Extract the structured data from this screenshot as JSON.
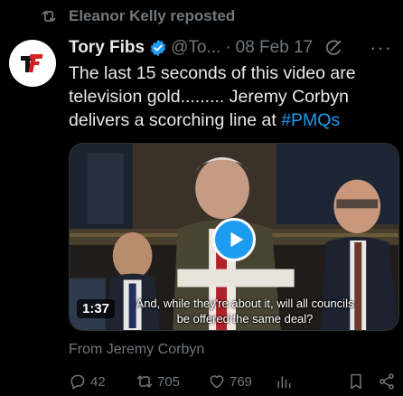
{
  "repost": {
    "icon": "repost-icon",
    "text": "Eleanor Kelly reposted"
  },
  "author": {
    "name": "Tory Fibs",
    "handle": "@To...",
    "separator": "·",
    "date": "08 Feb 17",
    "avatar_text": "TF"
  },
  "tweet": {
    "text_before": "The last 15 seconds of this video are television gold......... Jeremy Corbyn delivers a scorching line at ",
    "hashtag": "#PMQs"
  },
  "media": {
    "duration": "1:37",
    "caption_line1": "And, while they're about it, will all councils",
    "caption_line2": "be offered the same deal?"
  },
  "attribution": "From Jeremy Corbyn",
  "actions": {
    "replies": "42",
    "reposts": "705",
    "likes": "769"
  },
  "colors": {
    "accent": "#1d9bf0",
    "muted": "#71767b",
    "text": "#e7e9ea",
    "background": "#000000"
  }
}
